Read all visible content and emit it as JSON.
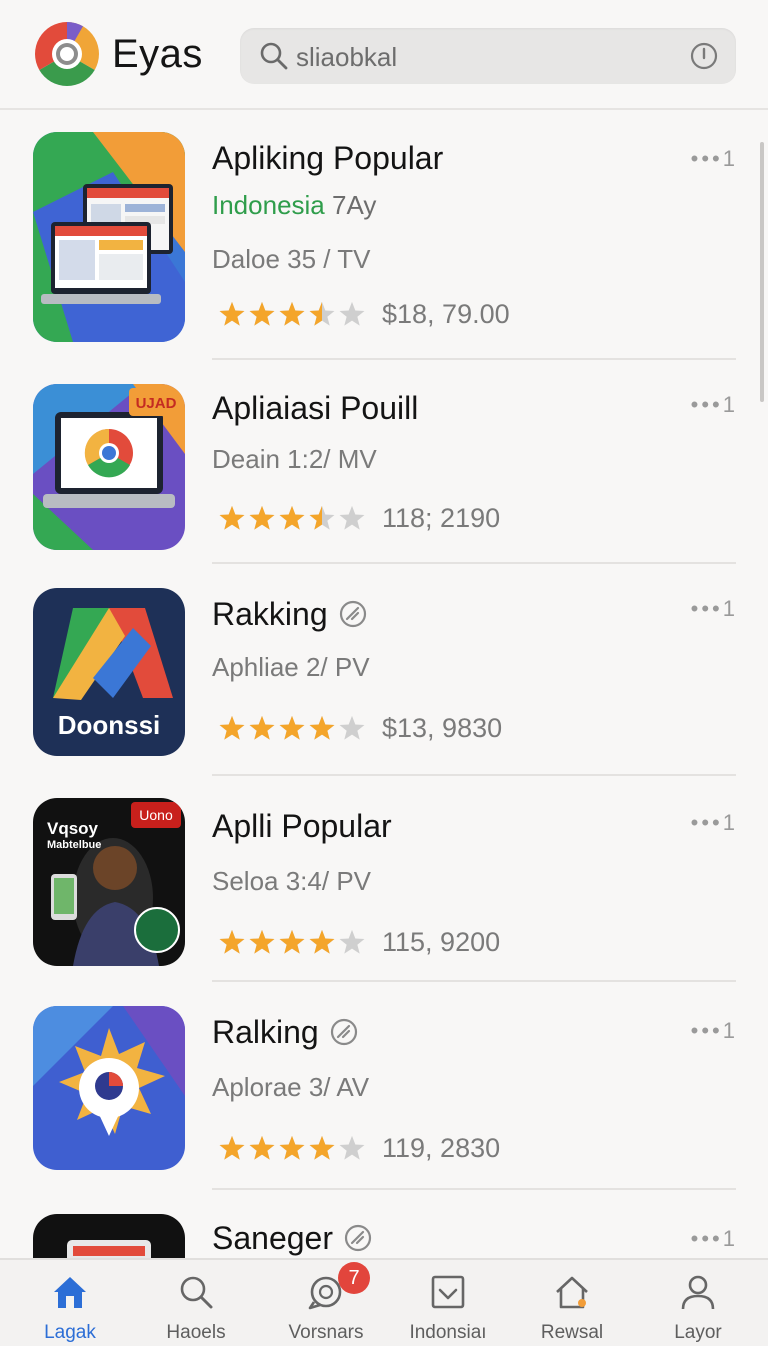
{
  "header": {
    "app_title": "Eyas",
    "search_query": "sliaobkal"
  },
  "apps": [
    {
      "title": "Apliking Popular",
      "subtitle_green": "Indonesia",
      "subtitle_gray": "7Ay",
      "meta": "Daloe 35 / TV",
      "rating": 3.5,
      "price": "$18, 79.00"
    },
    {
      "title": "Apliaiasi Pouill",
      "meta": "Deain 1:2/ MV",
      "rating": 3.5,
      "price": "118; 2190",
      "thumb_badge": "UJAD"
    },
    {
      "title": "Rakking",
      "meta": "Aphliae 2/ PV",
      "rating": 4,
      "price": "$13, 9830",
      "thumb_text": "Doonssi"
    },
    {
      "title": "Aplli Popular",
      "meta": "Seloa 3:4/ PV",
      "rating": 4,
      "price": "115, 9200",
      "thumb_badge": "Uono",
      "thumb_text1": "Vqsoy",
      "thumb_text2": "Mabtelbue"
    },
    {
      "title": "Ralking",
      "meta": "Aplorae 3/ AV",
      "rating": 4,
      "price": "119, 2830"
    },
    {
      "title": "Saneger"
    }
  ],
  "more_label": "•••1",
  "nav": [
    {
      "label": "Lagak",
      "icon": "home-icon",
      "active": true
    },
    {
      "label": "Haoels",
      "icon": "search-icon"
    },
    {
      "label": "Vorsnars",
      "icon": "chat-icon",
      "badge": "7"
    },
    {
      "label": "Indonsiaı",
      "icon": "download-box-icon"
    },
    {
      "label": "Rewsal",
      "icon": "house-badge-icon"
    },
    {
      "label": "Layor",
      "icon": "profile-icon"
    }
  ],
  "colors": {
    "accent": "#2c6ed6",
    "green": "#2f9d4b",
    "star": "#f4a52a",
    "star_empty": "#cfcfcf",
    "badge": "#e2453c"
  }
}
